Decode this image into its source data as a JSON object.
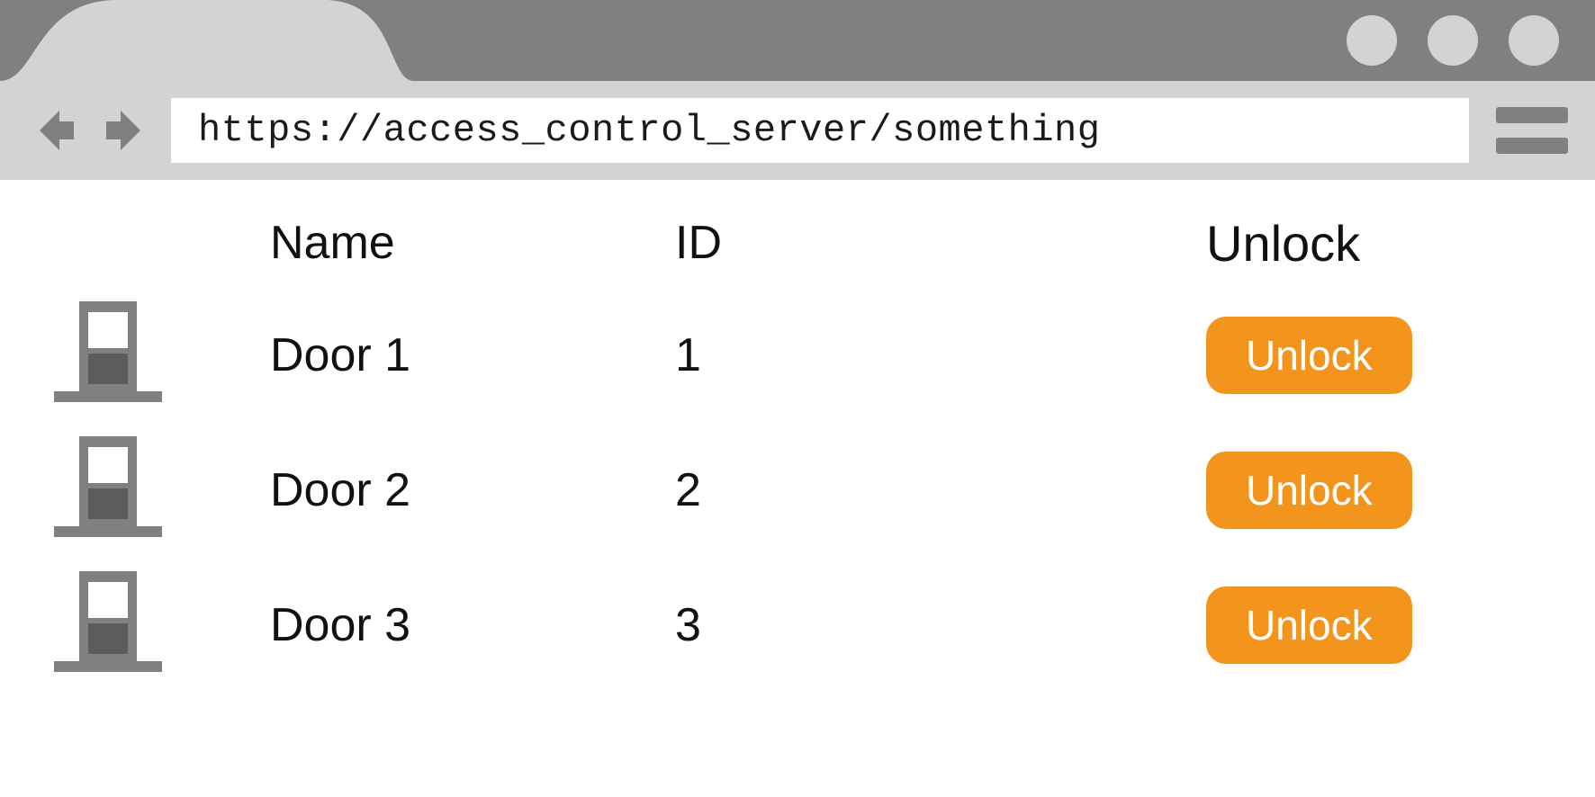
{
  "browser": {
    "url": "https://access_control_server/something"
  },
  "table": {
    "headers": {
      "name": "Name",
      "id": "ID",
      "unlock": "Unlock"
    },
    "rows": [
      {
        "name": "Door 1",
        "id": "1",
        "button": "Unlock"
      },
      {
        "name": "Door 2",
        "id": "2",
        "button": "Unlock"
      },
      {
        "name": "Door 3",
        "id": "3",
        "button": "Unlock"
      }
    ]
  }
}
